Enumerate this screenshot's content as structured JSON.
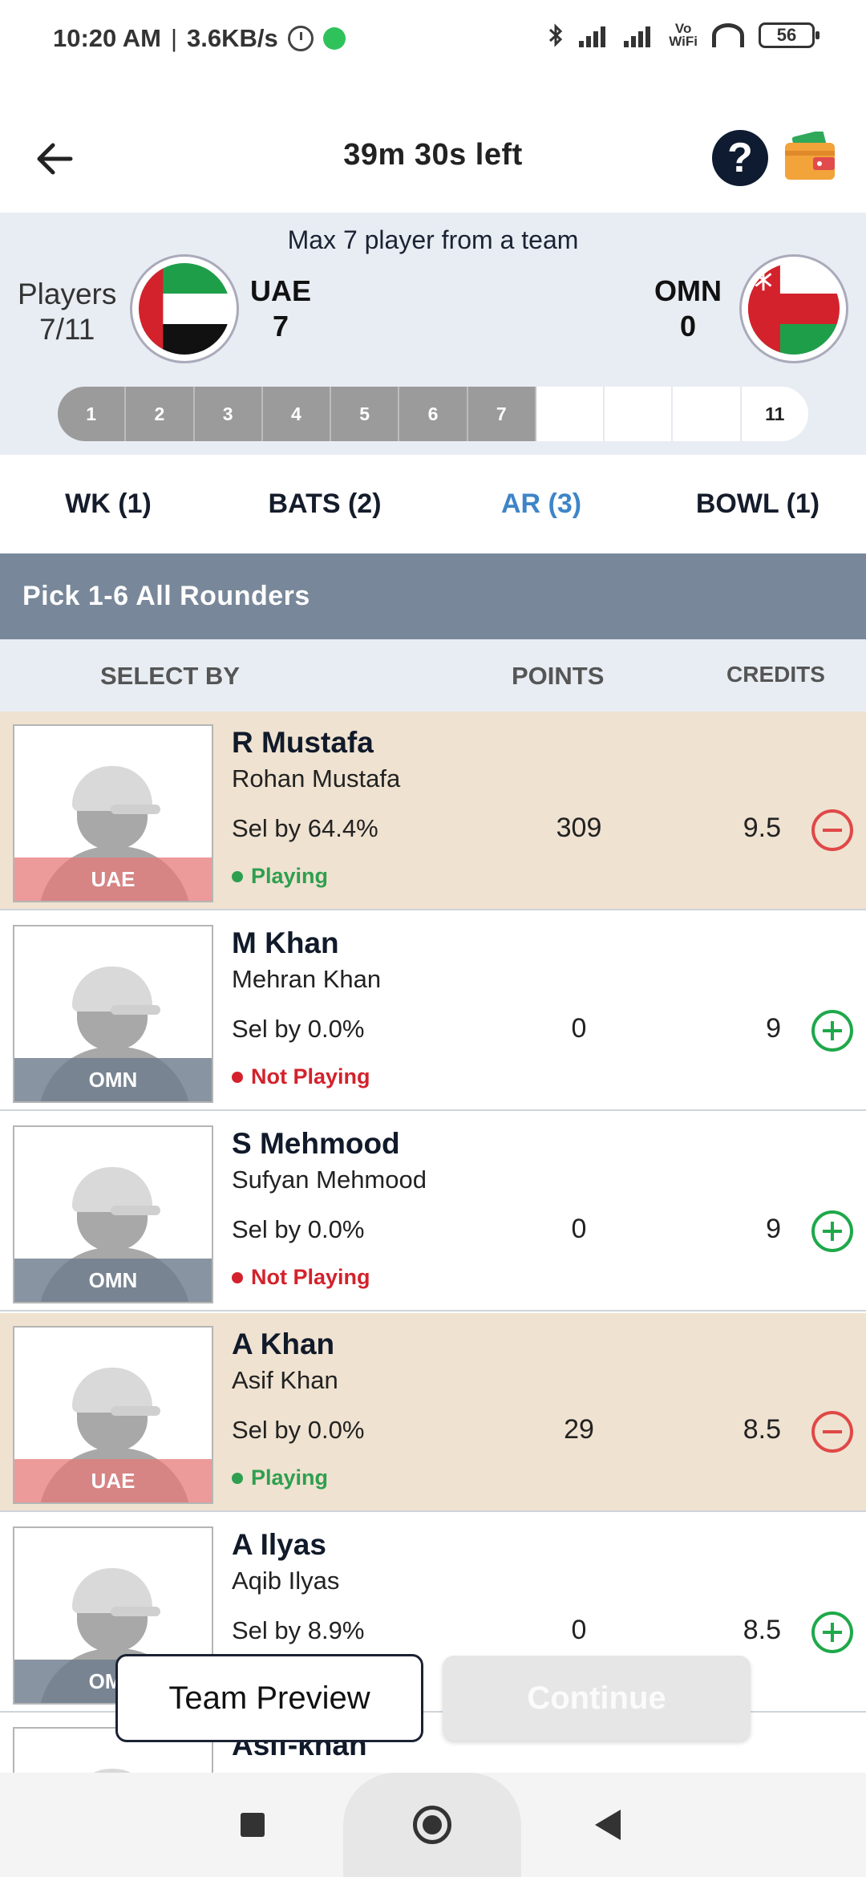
{
  "status_bar": {
    "time": "10:20 AM",
    "net_speed": "3.6KB/s",
    "vowifi_top": "Vo",
    "vowifi_bottom": "WiFi",
    "battery": "56"
  },
  "header": {
    "timer": "39m 30s left"
  },
  "team_panel": {
    "max_note": "Max 7 player from a team",
    "players_label": "Players",
    "players_count": "7/11",
    "team1_code": "UAE",
    "team1_count": "7",
    "team2_code": "OMN",
    "team2_count": "0",
    "progress_labels": [
      "1",
      "2",
      "3",
      "4",
      "5",
      "6",
      "7",
      "",
      "",
      "",
      "11"
    ],
    "filled": 7
  },
  "tabs": [
    {
      "label": "WK (1)"
    },
    {
      "label": "BATS (2)"
    },
    {
      "label": "AR (3)"
    },
    {
      "label": "BOWL (1)"
    }
  ],
  "active_tab": 2,
  "pick_banner": "Pick 1-6 All Rounders",
  "columns": {
    "select_by": "SELECT BY",
    "points": "POINTS",
    "credits": "CREDITS"
  },
  "players": [
    {
      "short": "R Mustafa",
      "full": "Rohan Mustafa",
      "sel": "Sel by 64.4%",
      "status": "Playing",
      "team": "UAE",
      "points": "309",
      "credits": "9.5",
      "selected": true
    },
    {
      "short": "M Khan",
      "full": "Mehran Khan",
      "sel": "Sel by 0.0%",
      "status": "Not Playing",
      "team": "OMN",
      "points": "0",
      "credits": "9",
      "selected": false
    },
    {
      "short": "S Mehmood",
      "full": "Sufyan Mehmood",
      "sel": "Sel by 0.0%",
      "status": "Not Playing",
      "team": "OMN",
      "points": "0",
      "credits": "9",
      "selected": false
    },
    {
      "short": "A Khan",
      "full": "Asif Khan",
      "sel": "Sel by 0.0%",
      "status": "Playing",
      "team": "UAE",
      "points": "29",
      "credits": "8.5",
      "selected": true
    },
    {
      "short": "A Ilyas",
      "full": "Aqib Ilyas",
      "sel": "Sel by 8.9%",
      "status": "",
      "team": "OMN",
      "points": "0",
      "credits": "8.5",
      "selected": false
    },
    {
      "short": "Asif-khan",
      "full": "",
      "sel": "",
      "status": "",
      "team": "",
      "points": "",
      "credits": "",
      "selected": false
    }
  ],
  "buttons": {
    "team_preview": "Team Preview",
    "continue": "Continue"
  },
  "colors": {
    "accent_tab": "#3e85c8",
    "banner": "#78889a",
    "selected_row": "#efe2d0",
    "playing": "#2e9f4f",
    "not_playing": "#d3222c"
  },
  "icons": {
    "back": "back-arrow-icon",
    "help": "help-icon",
    "wallet": "wallet-icon",
    "add": "add-circle-icon",
    "remove": "remove-circle-icon"
  }
}
